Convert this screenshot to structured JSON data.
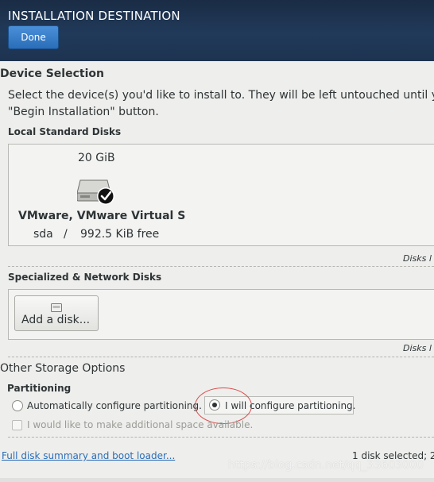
{
  "header": {
    "title": "INSTALLATION DESTINATION",
    "done_label": "Done"
  },
  "device_selection": {
    "heading": "Device Selection",
    "description_line1": "Select the device(s) you'd like to install to.  They will be left untouched until y",
    "description_line2": "\"Begin Installation\" button."
  },
  "local_disks": {
    "heading": "Local Standard Disks",
    "disk": {
      "size": "20 GiB",
      "name": "VMware, VMware Virtual S",
      "device": "sda",
      "separator": "/",
      "free": "992.5 KiB free",
      "icon": "hard-disk-icon",
      "selected": true
    },
    "note": "Disks l"
  },
  "network_disks": {
    "heading": "Specialized & Network Disks",
    "add_button_label": "Add a disk...",
    "note": "Disks l"
  },
  "other_storage": {
    "heading": "Other Storage Options",
    "partitioning_heading": "Partitioning",
    "auto_option": "Automatically configure partitioning.",
    "manual_option": "I will configure partitioning.",
    "selected": "manual",
    "extra_space_checkbox": "I would like to make additional space available.",
    "extra_space_checked": false
  },
  "footer": {
    "summary_link": "Full disk summary and boot loader...",
    "status": "1 disk selected; 2"
  },
  "watermark": "https://blog.csdn.net/qq_33603000",
  "colors": {
    "header_bg": "#1d3350",
    "done_button": "#3a7fcc",
    "link": "#2a6db8",
    "annotation": "#d94a4a"
  }
}
